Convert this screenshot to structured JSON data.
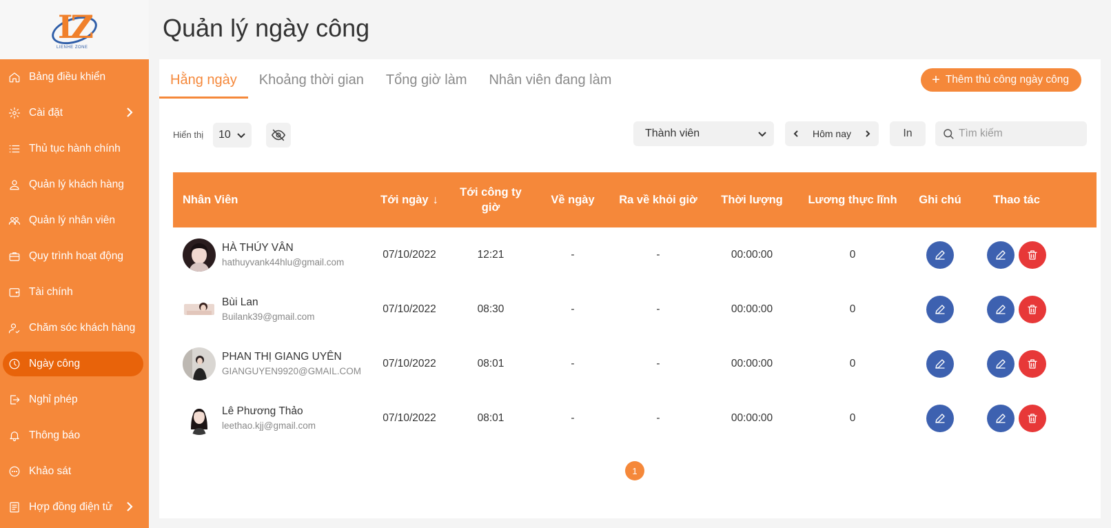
{
  "brand": {
    "logo_letters": "LZ",
    "logo_tagline": "LIENHE ZONE"
  },
  "page_title": "Quản lý ngày công",
  "sidebar": {
    "items": [
      {
        "label": "Bảng điều khiển",
        "icon": "home-icon",
        "chevron": false,
        "active": false
      },
      {
        "label": "Cài đặt",
        "icon": "gear-icon",
        "chevron": true,
        "active": false
      },
      {
        "label": "Thủ tục hành chính",
        "icon": "list-icon",
        "chevron": false,
        "active": false
      },
      {
        "label": "Quản lý khách hàng",
        "icon": "user-icon",
        "chevron": false,
        "active": false
      },
      {
        "label": "Quản lý nhân viên",
        "icon": "users-icon",
        "chevron": false,
        "active": false
      },
      {
        "label": "Quy trình hoạt động",
        "icon": "briefcase-icon",
        "chevron": false,
        "active": false
      },
      {
        "label": "Tài chính",
        "icon": "wallet-icon",
        "chevron": false,
        "active": false
      },
      {
        "label": "Chăm sóc khách hàng",
        "icon": "user-care-icon",
        "chevron": false,
        "active": false
      },
      {
        "label": "Ngày công",
        "icon": "clock-icon",
        "chevron": false,
        "active": true
      },
      {
        "label": "Nghỉ phép",
        "icon": "logout-icon",
        "chevron": false,
        "active": false
      },
      {
        "label": "Thông báo",
        "icon": "bell-icon",
        "chevron": false,
        "active": false
      },
      {
        "label": "Khảo sát",
        "icon": "chat-icon",
        "chevron": false,
        "active": false
      },
      {
        "label": "Hợp đồng điện tử",
        "icon": "document-icon",
        "chevron": true,
        "active": false
      }
    ]
  },
  "tabs": [
    {
      "label": "Hằng ngày",
      "active": true
    },
    {
      "label": "Khoảng thời gian",
      "active": false
    },
    {
      "label": "Tổng giờ làm",
      "active": false
    },
    {
      "label": "Nhân viên đang làm",
      "active": false
    }
  ],
  "add_button": {
    "label": "Thêm thủ công ngày công",
    "icon": "plus-icon"
  },
  "toolbar": {
    "show_label": "Hiển thị",
    "page_size": "10",
    "visibility_icon": "eye-off-icon",
    "member_select": "Thành viên",
    "date_label": "Hôm nay",
    "print_label": "In",
    "search_placeholder": "Tìm kiếm"
  },
  "table": {
    "headers": [
      "Nhân Viên",
      "Tới ngày",
      "Tới công ty giờ",
      "Về ngày",
      "Ra về khỏi giờ",
      "Thời lượng",
      "Lương thực lĩnh",
      "Ghi chú",
      "Thao tác"
    ],
    "sort_indicator": "↓",
    "rows": [
      {
        "name": "HÀ THÚY VÂN",
        "email": "hathuyvank44hlu@gmail.com",
        "date_in": "07/10/2022",
        "time_in": "12:21",
        "date_out": "-",
        "time_out": "-",
        "duration": "00:00:00",
        "salary": "0"
      },
      {
        "name": "Bùi Lan",
        "email": "Builank39@gmail.com",
        "date_in": "07/10/2022",
        "time_in": "08:30",
        "date_out": "-",
        "time_out": "-",
        "duration": "00:00:00",
        "salary": "0"
      },
      {
        "name": "PHAN THỊ GIANG UYÊN",
        "email": "GIANGUYEN9920@GMAIL.COM",
        "date_in": "07/10/2022",
        "time_in": "08:01",
        "date_out": "-",
        "time_out": "-",
        "duration": "00:00:00",
        "salary": "0"
      },
      {
        "name": "Lê Phương Thảo",
        "email": "leethao.kjj@gmail.com",
        "date_in": "07/10/2022",
        "time_in": "08:01",
        "date_out": "-",
        "time_out": "-",
        "duration": "00:00:00",
        "salary": "0"
      }
    ]
  },
  "pagination": {
    "current_page": "1"
  },
  "colors": {
    "accent": "#f5883a",
    "active_nav": "#e8630a",
    "edit_button": "#3d61b0",
    "delete_button": "#e73838"
  }
}
